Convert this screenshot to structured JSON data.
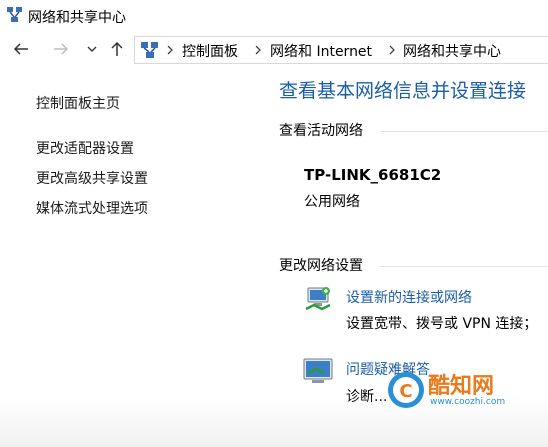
{
  "window": {
    "title": "网络和共享中心"
  },
  "address_bar": {
    "crumbs": [
      "控制面板",
      "网络和 Internet",
      "网络和共享中心"
    ]
  },
  "sidebar": {
    "items": [
      {
        "label": "控制面板主页"
      },
      {
        "label": "更改适配器设置"
      },
      {
        "label": "更改高级共享设置"
      },
      {
        "label": "媒体流式处理选项"
      }
    ]
  },
  "main": {
    "heading": "查看基本网络信息并设置连接",
    "active_networks_title": "查看活动网络",
    "network_name": "TP-LINK_6681C2",
    "network_type": "公用网络",
    "change_settings_title": "更改网络设置",
    "tasks": [
      {
        "link": "设置新的连接或网络",
        "desc": "设置宽带、拨号或 VPN 连接；"
      },
      {
        "link": "问题疑难解答",
        "desc": "诊断..."
      }
    ]
  },
  "watermark": {
    "brand": "酷知网",
    "url": "www.coozhi.com",
    "logo_letter": "C"
  },
  "colors": {
    "heading": "#1a5ea8",
    "link": "#1a5ea8",
    "watermark_orange": "#ea7a1c",
    "watermark_blue": "#2a8fd6"
  }
}
